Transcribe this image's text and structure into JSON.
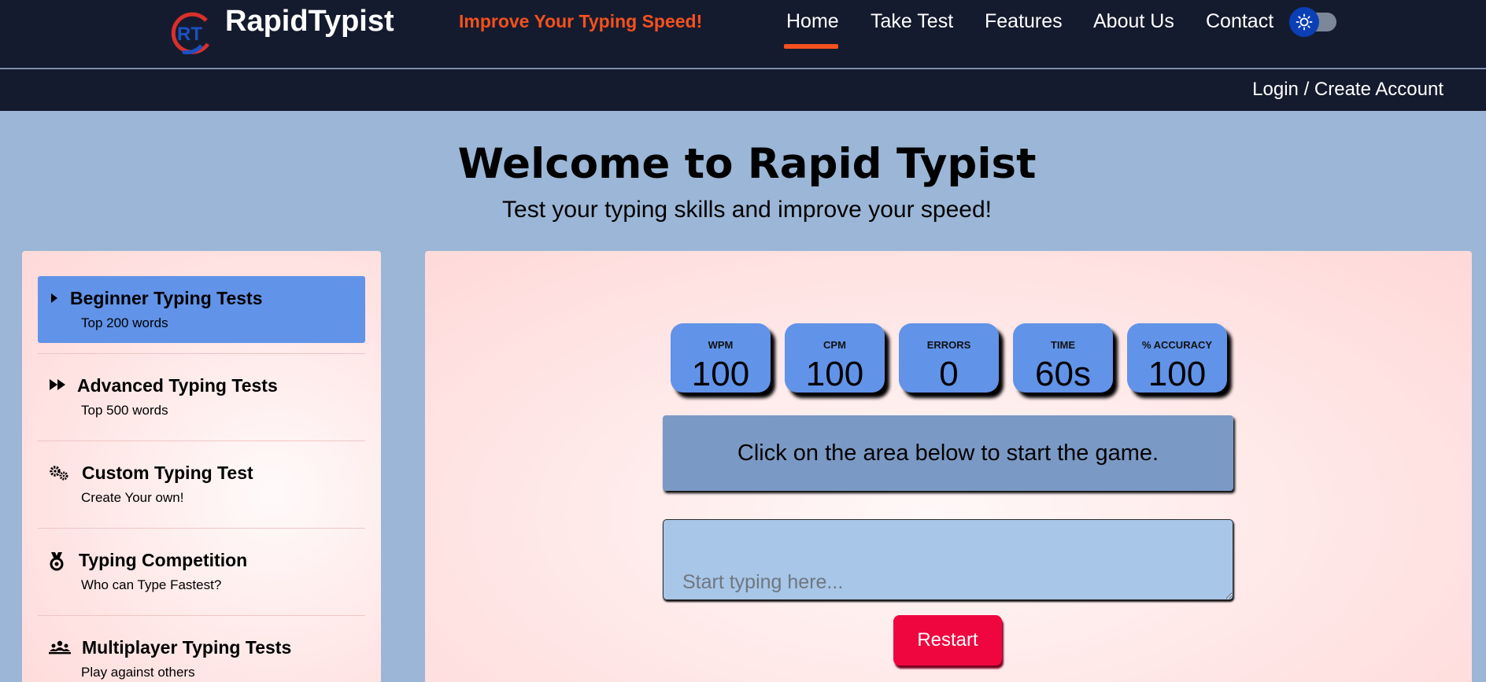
{
  "header": {
    "brand": "RapidTypist",
    "logo_text": "RT",
    "tagline": "Improve Your Typing Speed!",
    "nav": [
      {
        "label": "Home",
        "active": true
      },
      {
        "label": "Take Test",
        "active": false
      },
      {
        "label": "Features",
        "active": false
      },
      {
        "label": "About Us",
        "active": false
      },
      {
        "label": "Contact",
        "active": false
      }
    ],
    "theme_toggle_icon": "sun-icon",
    "login_label": "Login / Create Account"
  },
  "hero": {
    "title": "Welcome to Rapid Typist",
    "subtitle": "Test your typing skills and improve your speed!"
  },
  "sidebar": {
    "items": [
      {
        "title": "Beginner Typing Tests",
        "desc": "Top 200 words",
        "icon": "play-icon",
        "active": true
      },
      {
        "title": "Advanced Typing Tests",
        "desc": "Top 500 words",
        "icon": "fast-forward-icon",
        "active": false
      },
      {
        "title": "Custom Typing Test",
        "desc": "Create Your own!",
        "icon": "gears-icon",
        "active": false
      },
      {
        "title": "Typing Competition",
        "desc": "Who can Type Fastest?",
        "icon": "medal-icon",
        "active": false
      },
      {
        "title": "Multiplayer Typing Tests",
        "desc": "Play against others",
        "icon": "people-group-icon",
        "active": false
      }
    ]
  },
  "stats": [
    {
      "label": "WPM",
      "value": "100"
    },
    {
      "label": "CPM",
      "value": "100"
    },
    {
      "label": "ERRORS",
      "value": "0"
    },
    {
      "label": "TIME",
      "value": "60s"
    },
    {
      "label": "% ACCURACY",
      "value": "100"
    }
  ],
  "game": {
    "instruction": "Click on the area below to start the game.",
    "input_placeholder": "Start typing here...",
    "input_value": "",
    "restart_label": "Restart"
  },
  "colors": {
    "nav_bg": "#151b2e",
    "accent_orange": "#f4511e",
    "stat_blue": "#6193e8",
    "restart_red": "#f0063f",
    "page_bg": "#9bb6d6"
  }
}
